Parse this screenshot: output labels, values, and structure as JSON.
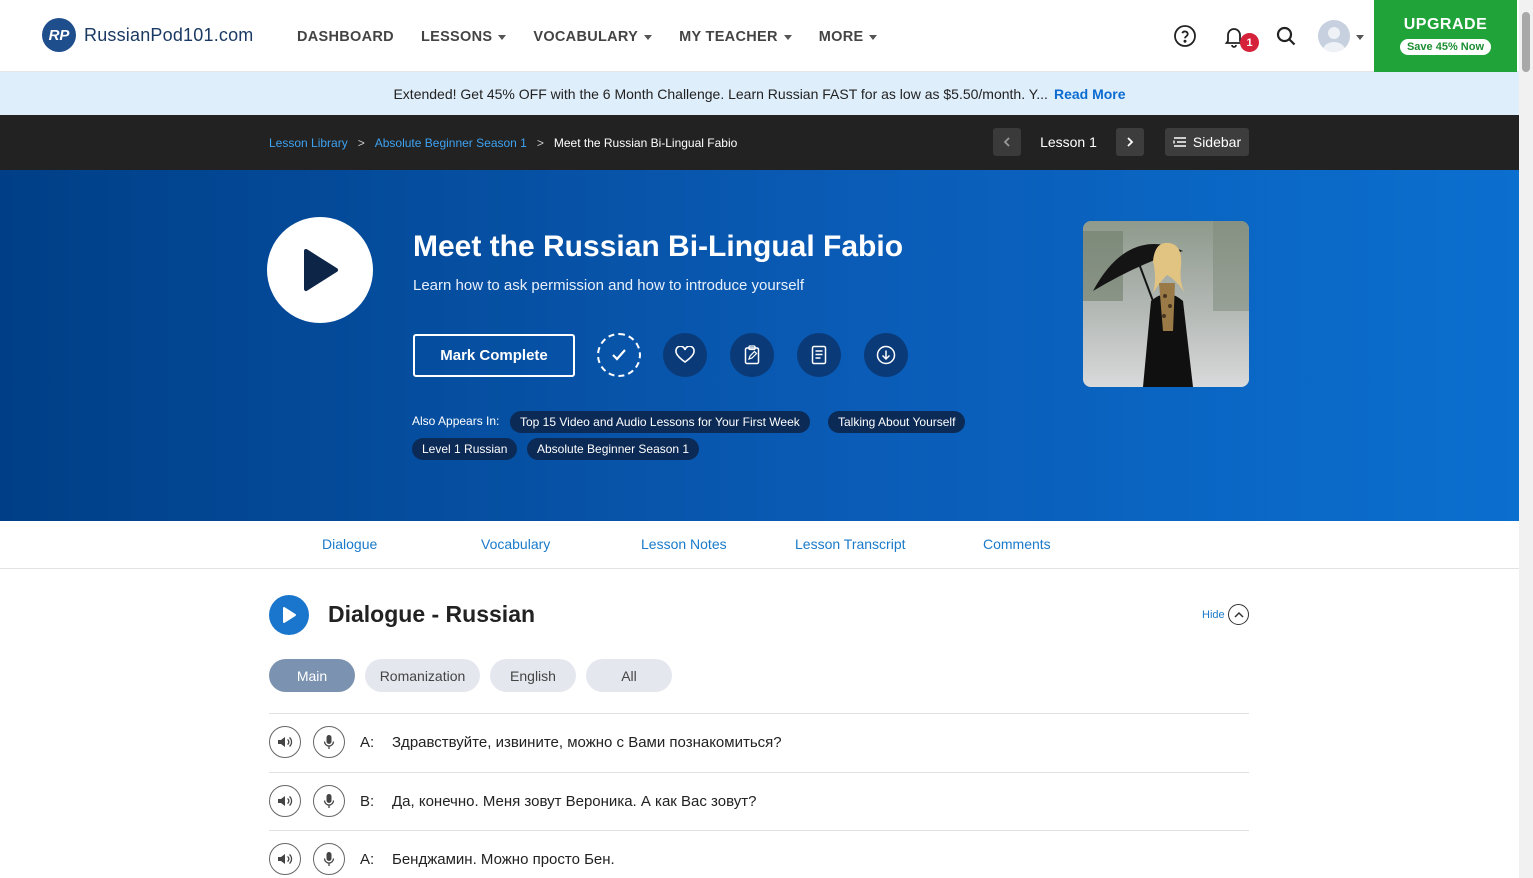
{
  "header": {
    "logo_text": "RussianPod101.com",
    "logo_mark": "RP",
    "menu": [
      {
        "label": "DASHBOARD",
        "dropdown": false
      },
      {
        "label": "LESSONS",
        "dropdown": true
      },
      {
        "label": "VOCABULARY",
        "dropdown": true
      },
      {
        "label": "MY TEACHER",
        "dropdown": true
      },
      {
        "label": "MORE",
        "dropdown": true
      }
    ],
    "notification_count": "1",
    "upgrade_title": "UPGRADE",
    "upgrade_sub": "Save 45% Now"
  },
  "promo": {
    "text": "Extended! Get 45% OFF with the 6 Month Challenge. Learn Russian FAST for as low as $5.50/month. Y...",
    "link": "Read More"
  },
  "breadcrumb": {
    "items": [
      "Lesson Library",
      "Absolute Beginner Season 1"
    ],
    "current": "Meet the Russian Bi-Lingual Fabio",
    "separator": ">",
    "lesson_label": "Lesson 1",
    "sidebar_label": "Sidebar"
  },
  "hero": {
    "title": "Meet the Russian Bi-Lingual Fabio",
    "subtitle": "Learn how to ask permission and how to introduce yourself",
    "mark_complete": "Mark Complete",
    "also_label": "Also Appears In:",
    "tags": [
      "Top 15 Video and Audio Lessons for Your First Week",
      "Talking About Yourself",
      "Level 1 Russian",
      "Absolute Beginner Season 1"
    ]
  },
  "tabs": [
    "Dialogue",
    "Vocabulary",
    "Lesson Notes",
    "Lesson Transcript",
    "Comments"
  ],
  "dialogue": {
    "title": "Dialogue - Russian",
    "hide": "Hide",
    "pills": [
      "Main",
      "Romanization",
      "English",
      "All"
    ],
    "active_pill": "Main",
    "lines": [
      {
        "speaker": "A:",
        "text": "Здравствуйте, извините, можно с Вами познакомиться?"
      },
      {
        "speaker": "B:",
        "text": "Да, конечно. Меня зовут Вероника. А как Вас зовут?"
      },
      {
        "speaker": "A:",
        "text": "Бенджамин. Можно просто Бен."
      }
    ]
  },
  "colors": {
    "brand_blue": "#0a5bb5",
    "upgrade_green": "#20a339",
    "link_blue": "#1a7ac9",
    "badge_red": "#d6213a"
  }
}
